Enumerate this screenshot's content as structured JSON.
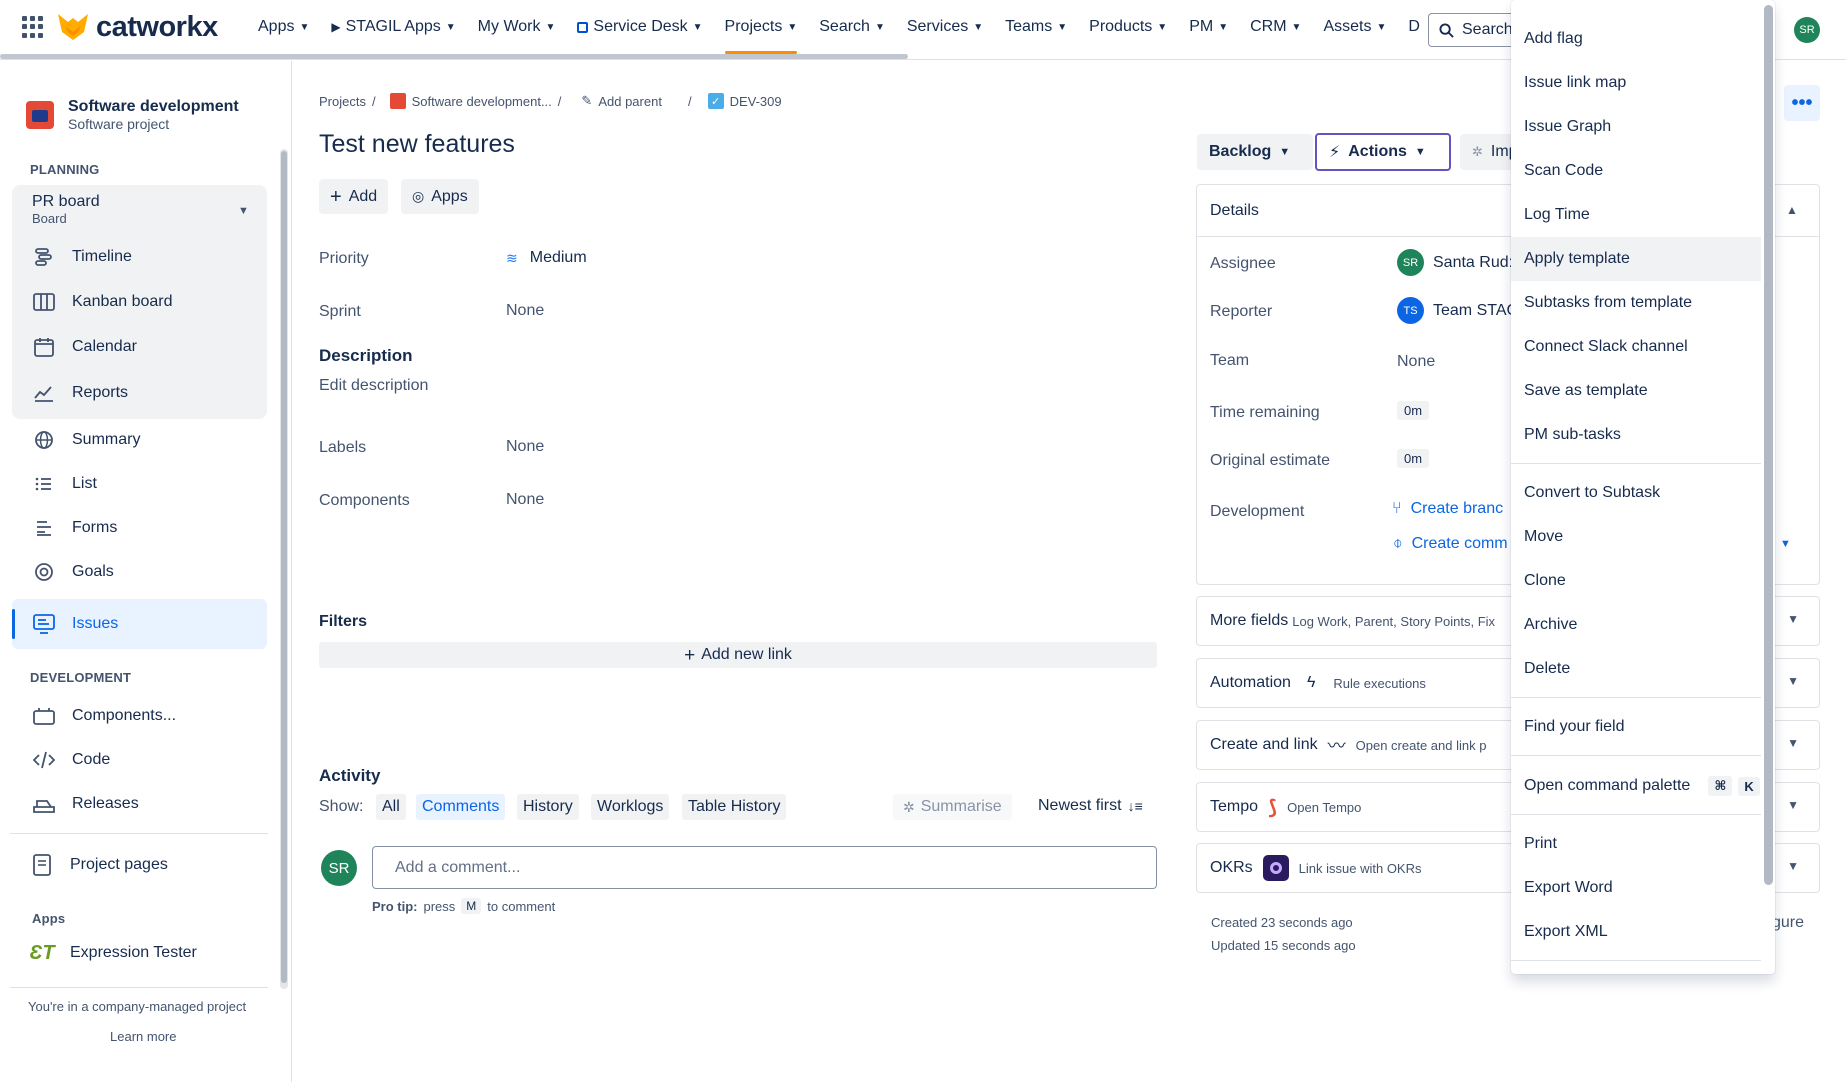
{
  "topnav": {
    "logo": "catworkx",
    "items": [
      {
        "label": "Apps"
      },
      {
        "label": "STAGIL Apps"
      },
      {
        "label": "My Work"
      },
      {
        "label": "Service Desk"
      },
      {
        "label": "Projects"
      },
      {
        "label": "Search"
      },
      {
        "label": "Services"
      },
      {
        "label": "Teams"
      },
      {
        "label": "Products"
      },
      {
        "label": "PM"
      },
      {
        "label": "CRM"
      },
      {
        "label": "Assets"
      },
      {
        "label": "D"
      }
    ],
    "search_label": "Search",
    "avatar": "SR",
    "active_color": "#ff8b00"
  },
  "sidebar": {
    "project_name": "Software development",
    "project_type": "Software project",
    "planning_heading": "PLANNING",
    "board_name": "PR board",
    "board_type": "Board",
    "planning_items": [
      {
        "label": "Timeline",
        "icon": "timeline-icon"
      },
      {
        "label": "Kanban board",
        "icon": "kanban-icon"
      },
      {
        "label": "Calendar",
        "icon": "calendar-icon"
      },
      {
        "label": "Reports",
        "icon": "reports-icon"
      }
    ],
    "items": [
      {
        "label": "Summary",
        "icon": "globe-icon"
      },
      {
        "label": "List",
        "icon": "list-icon"
      },
      {
        "label": "Forms",
        "icon": "forms-icon"
      },
      {
        "label": "Goals",
        "icon": "goals-icon"
      },
      {
        "label": "Issues",
        "icon": "issues-icon"
      }
    ],
    "development_heading": "DEVELOPMENT",
    "dev_items": [
      {
        "label": "Components...",
        "icon": "components-icon"
      },
      {
        "label": "Code",
        "icon": "code-icon"
      },
      {
        "label": "Releases",
        "icon": "releases-icon"
      }
    ],
    "project_pages": "Project pages",
    "apps_heading": "Apps",
    "expression_tester": "Expression Tester",
    "footer_text": "You're in a company-managed project",
    "learn_more": "Learn more"
  },
  "breadcrumb": {
    "projects": "Projects",
    "project": "Software development...",
    "add_parent": "Add parent",
    "issue_key": "DEV-309",
    "separator": "/"
  },
  "issue": {
    "title": "Test new features",
    "add_button": "Add",
    "apps_button": "Apps",
    "priority_label": "Priority",
    "priority_value": "Medium",
    "sprint_label": "Sprint",
    "sprint_value": "None",
    "description_heading": "Description",
    "description_placeholder": "Edit description",
    "labels_label": "Labels",
    "labels_value": "None",
    "components_label": "Components",
    "components_value": "None",
    "filters_heading": "Filters",
    "add_new_link": "Add new link"
  },
  "activity": {
    "heading": "Activity",
    "show_label": "Show:",
    "tabs": [
      "All",
      "Comments",
      "History",
      "Worklogs",
      "Table History"
    ],
    "summarise": "Summarise",
    "sort": "Newest first",
    "avatar": "SR",
    "comment_placeholder": "Add a comment...",
    "protip_prefix": "Pro tip:",
    "protip_press": "press",
    "protip_key": "M",
    "protip_suffix": "to comment"
  },
  "right": {
    "status_button": "Backlog",
    "actions_button": "Actions",
    "improve_button": "Imp",
    "details_heading": "Details",
    "assignee_label": "Assignee",
    "assignee_avatar": "SR",
    "assignee_value": "Santa Rud:",
    "reporter_label": "Reporter",
    "reporter_avatar": "TS",
    "reporter_value": "Team STAG",
    "team_label": "Team",
    "team_value": "None",
    "time_remaining_label": "Time remaining",
    "time_remaining_value": "0m",
    "original_estimate_label": "Original estimate",
    "original_estimate_value": "0m",
    "development_label": "Development",
    "create_branch": "Create branc",
    "create_commit": "Create comm",
    "more_fields": "More fields",
    "more_fields_sub": "Log Work, Parent, Story Points, Fix",
    "automation": "Automation",
    "automation_sub": "Rule executions",
    "create_and_link": "Create and link",
    "create_and_link_sub": "Open create and link p",
    "tempo": "Tempo",
    "tempo_sub": "Open Tempo",
    "okrs": "OKRs",
    "okrs_sub": "Link issue with OKRs",
    "created": "Created 23 seconds ago",
    "updated": "Updated 15 seconds ago",
    "configure_partial": "gure"
  },
  "menu": {
    "groups": [
      [
        "Add flag",
        "Issue link map",
        "Issue Graph",
        "Scan Code",
        "Log Time",
        "Apply template",
        "Subtasks from template",
        "Connect Slack channel",
        "Save as template",
        "PM sub-tasks"
      ],
      [
        "Convert to Subtask",
        "Move",
        "Clone",
        "Archive",
        "Delete"
      ],
      [
        "Find your field"
      ],
      [
        "Open command palette"
      ],
      [
        "Print",
        "Export Word",
        "Export XML"
      ]
    ],
    "hovered": "Apply template",
    "shortcut_cmd": "⌘",
    "shortcut_key": "K"
  }
}
